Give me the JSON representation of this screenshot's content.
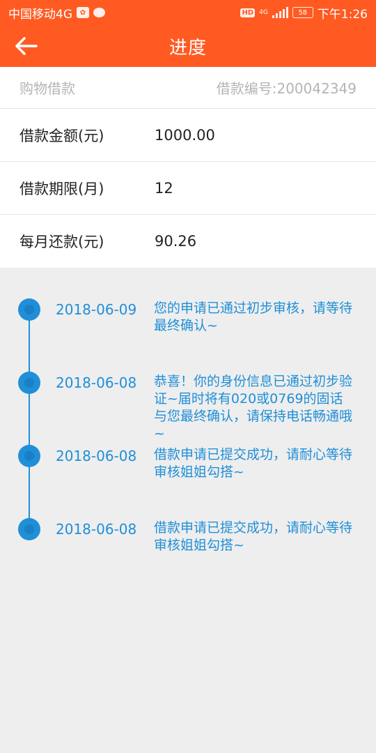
{
  "status_bar": {
    "carrier": "中国移动4G",
    "hd": "HD",
    "network": "4G",
    "battery": "58",
    "time": "下午1:26"
  },
  "app_bar": {
    "title": "进度",
    "back_icon": "arrow-left-icon"
  },
  "loan": {
    "type": "购物借款",
    "number": "借款编号:200042349",
    "rows": [
      {
        "label": "借款金额(元)",
        "value": "1000.00"
      },
      {
        "label": "借款期限(月)",
        "value": "12"
      },
      {
        "label": "每月还款(元)",
        "value": "90.26"
      }
    ]
  },
  "timeline": {
    "items": [
      {
        "date": "2018-06-09",
        "text": "您的申请已通过初步审核，请等待最终确认~"
      },
      {
        "date": "2018-06-08",
        "text": "恭喜！你的身份信息已通过初步验证~届时将有020或0769的固话与您最终确认，请保持电话畅通哦~"
      },
      {
        "date": "2018-06-08",
        "text": "借款申请已提交成功，请耐心等待审核姐姐勾搭~"
      },
      {
        "date": "2018-06-08",
        "text": "借款申请已提交成功，请耐心等待审核姐姐勾搭~"
      }
    ]
  },
  "colors": {
    "accent": "#ff5a22",
    "timeline": "#1f8fd8",
    "background": "#eeeeee"
  }
}
